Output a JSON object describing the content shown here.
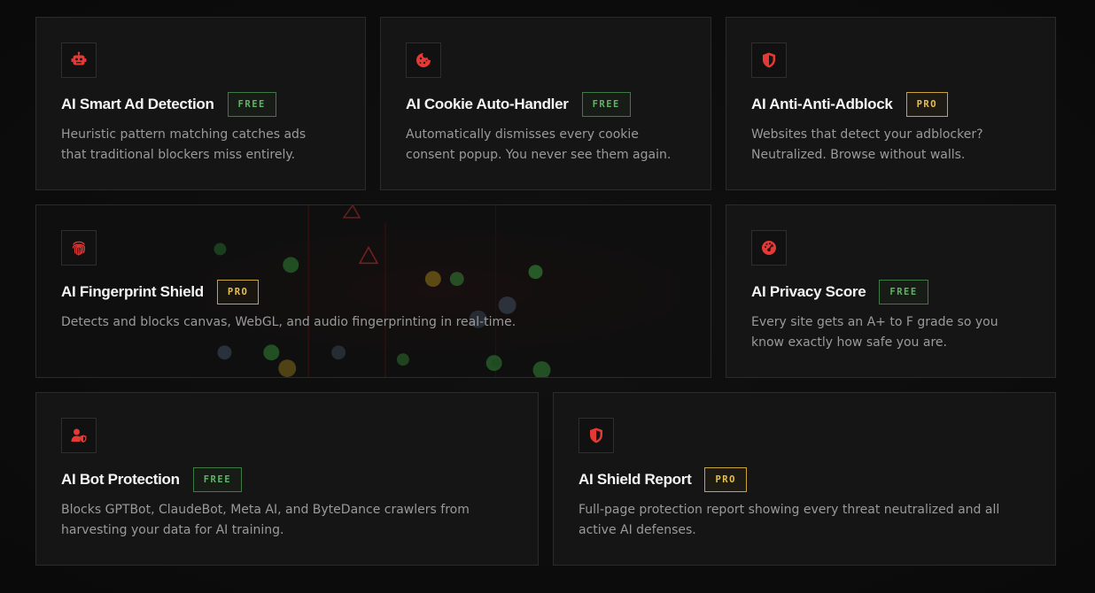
{
  "colors": {
    "accent_red": "#e53935",
    "free_green": "#5fb366",
    "pro_gold": "#e8c14a",
    "card_bg": "#151515",
    "page_bg": "#0c0c0c"
  },
  "features": [
    {
      "icon": "robot-icon",
      "title": "AI Smart Ad Detection",
      "badge": "FREE",
      "description": "Heuristic pattern matching catches ads that traditional blockers miss entirely."
    },
    {
      "icon": "cookie-icon",
      "title": "AI Cookie Auto-Handler",
      "badge": "FREE",
      "description": "Automatically dismisses every cookie consent popup. You never see them again."
    },
    {
      "icon": "shield-icon",
      "title": "AI Anti-Anti-Adblock",
      "badge": "PRO",
      "description": "Websites that detect your adblocker? Neutralized. Browse without walls."
    },
    {
      "icon": "fingerprint-icon",
      "title": "AI Fingerprint Shield",
      "badge": "PRO",
      "description": "Detects and blocks canvas, WebGL, and audio fingerprinting in real-time."
    },
    {
      "icon": "gauge-icon",
      "title": "AI Privacy Score",
      "badge": "FREE",
      "description": "Every site gets an A+ to F grade so you know exactly how safe you are."
    },
    {
      "icon": "user-shield-icon",
      "title": "AI Bot Protection",
      "badge": "FREE",
      "description": "Blocks GPTBot, ClaudeBot, Meta AI, and ByteDance crawlers from harvesting your data for AI training."
    },
    {
      "icon": "shield-icon",
      "title": "AI Shield Report",
      "badge": "PRO",
      "description": "Full-page protection report showing every threat neutralized and all active AI defenses."
    }
  ]
}
